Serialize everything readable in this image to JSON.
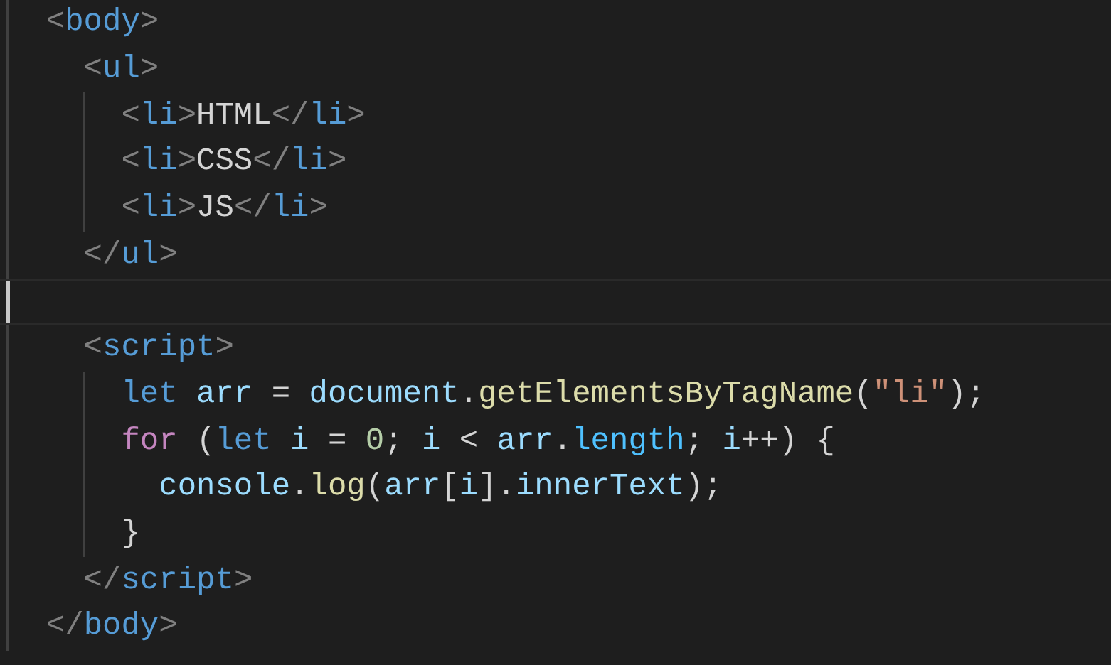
{
  "editor": {
    "lines": [
      {
        "current": false,
        "tokens": [
          {
            "kind": "bracket",
            "text": "  <"
          },
          {
            "kind": "tag",
            "text": "body"
          },
          {
            "kind": "bracket",
            "text": ">"
          }
        ]
      },
      {
        "current": false,
        "tokens": [
          {
            "kind": "bracket",
            "text": "    <"
          },
          {
            "kind": "tag",
            "text": "ul"
          },
          {
            "kind": "bracket",
            "text": ">"
          }
        ]
      },
      {
        "current": false,
        "tokens": [
          {
            "kind": "bracket",
            "text": "      <"
          },
          {
            "kind": "tag",
            "text": "li"
          },
          {
            "kind": "bracket",
            "text": ">"
          },
          {
            "kind": "plain",
            "text": "HTML"
          },
          {
            "kind": "bracket",
            "text": "</"
          },
          {
            "kind": "tag",
            "text": "li"
          },
          {
            "kind": "bracket",
            "text": ">"
          }
        ]
      },
      {
        "current": false,
        "tokens": [
          {
            "kind": "bracket",
            "text": "      <"
          },
          {
            "kind": "tag",
            "text": "li"
          },
          {
            "kind": "bracket",
            "text": ">"
          },
          {
            "kind": "plain",
            "text": "CSS"
          },
          {
            "kind": "bracket",
            "text": "</"
          },
          {
            "kind": "tag",
            "text": "li"
          },
          {
            "kind": "bracket",
            "text": ">"
          }
        ]
      },
      {
        "current": false,
        "tokens": [
          {
            "kind": "bracket",
            "text": "      <"
          },
          {
            "kind": "tag",
            "text": "li"
          },
          {
            "kind": "bracket",
            "text": ">"
          },
          {
            "kind": "plain",
            "text": "JS"
          },
          {
            "kind": "bracket",
            "text": "</"
          },
          {
            "kind": "tag",
            "text": "li"
          },
          {
            "kind": "bracket",
            "text": ">"
          }
        ]
      },
      {
        "current": false,
        "tokens": [
          {
            "kind": "bracket",
            "text": "    </"
          },
          {
            "kind": "tag",
            "text": "ul"
          },
          {
            "kind": "bracket",
            "text": ">"
          }
        ]
      },
      {
        "current": true
      },
      {
        "current": false,
        "tokens": [
          {
            "kind": "bracket",
            "text": "    <"
          },
          {
            "kind": "tag",
            "text": "script"
          },
          {
            "kind": "bracket",
            "text": ">"
          }
        ]
      },
      {
        "current": false,
        "tokens": [
          {
            "kind": "keyword",
            "text": "      let "
          },
          {
            "kind": "variable",
            "text": "arr"
          },
          {
            "kind": "plain",
            "text": " = "
          },
          {
            "kind": "variable",
            "text": "document"
          },
          {
            "kind": "plain",
            "text": "."
          },
          {
            "kind": "function",
            "text": "getElementsByTagName"
          },
          {
            "kind": "plain",
            "text": "("
          },
          {
            "kind": "string",
            "text": "\"li\""
          },
          {
            "kind": "plain",
            "text": ");"
          }
        ]
      },
      {
        "current": false,
        "tokens": [
          {
            "kind": "control",
            "text": "      for"
          },
          {
            "kind": "plain",
            "text": " ("
          },
          {
            "kind": "keyword",
            "text": "let "
          },
          {
            "kind": "variable",
            "text": "i"
          },
          {
            "kind": "plain",
            "text": " = "
          },
          {
            "kind": "number",
            "text": "0"
          },
          {
            "kind": "plain",
            "text": "; "
          },
          {
            "kind": "variable",
            "text": "i"
          },
          {
            "kind": "plain",
            "text": " < "
          },
          {
            "kind": "variable",
            "text": "arr"
          },
          {
            "kind": "plain",
            "text": "."
          },
          {
            "kind": "property",
            "text": "length"
          },
          {
            "kind": "plain",
            "text": "; "
          },
          {
            "kind": "variable",
            "text": "i"
          },
          {
            "kind": "plain",
            "text": "++) {"
          }
        ]
      },
      {
        "current": false,
        "tokens": [
          {
            "kind": "variable",
            "text": "        console"
          },
          {
            "kind": "plain",
            "text": "."
          },
          {
            "kind": "function",
            "text": "log"
          },
          {
            "kind": "plain",
            "text": "("
          },
          {
            "kind": "variable",
            "text": "arr"
          },
          {
            "kind": "plain",
            "text": "["
          },
          {
            "kind": "variable",
            "text": "i"
          },
          {
            "kind": "plain",
            "text": "]."
          },
          {
            "kind": "variable",
            "text": "innerText"
          },
          {
            "kind": "plain",
            "text": ");"
          }
        ]
      },
      {
        "current": false,
        "tokens": [
          {
            "kind": "plain",
            "text": "      }"
          }
        ]
      },
      {
        "current": false,
        "tokens": [
          {
            "kind": "bracket",
            "text": "    </"
          },
          {
            "kind": "tag",
            "text": "script"
          },
          {
            "kind": "bracket",
            "text": ">"
          }
        ]
      },
      {
        "current": false,
        "tokens": [
          {
            "kind": "bracket",
            "text": "  </"
          },
          {
            "kind": "tag",
            "text": "body"
          },
          {
            "kind": "bracket",
            "text": ">"
          }
        ]
      }
    ]
  }
}
